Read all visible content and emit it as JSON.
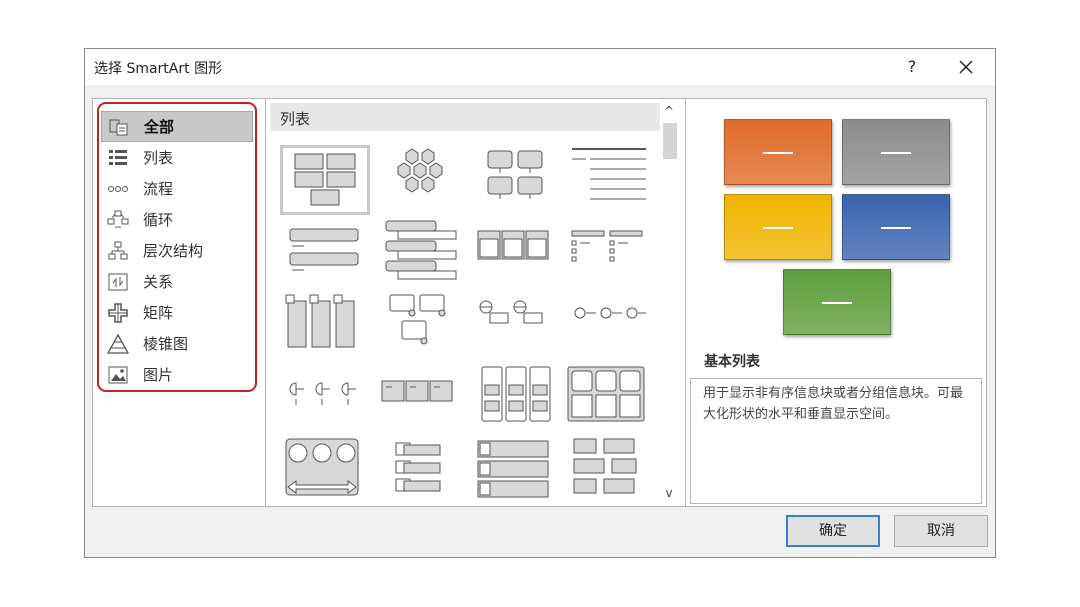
{
  "dialog": {
    "title": "选择 SmartArt 图形",
    "help": "?"
  },
  "categories": [
    {
      "label": "全部",
      "icon": "all-layouts-icon",
      "selected": true
    },
    {
      "label": "列表",
      "icon": "list-icon"
    },
    {
      "label": "流程",
      "icon": "process-icon"
    },
    {
      "label": "循环",
      "icon": "cycle-icon"
    },
    {
      "label": "层次结构",
      "icon": "hierarchy-icon"
    },
    {
      "label": "关系",
      "icon": "relationship-icon"
    },
    {
      "label": "矩阵",
      "icon": "matrix-icon"
    },
    {
      "label": "棱锥图",
      "icon": "pyramid-icon"
    },
    {
      "label": "图片",
      "icon": "picture-icon"
    }
  ],
  "gallery": {
    "heading": "列表",
    "scroll_up": "^",
    "scroll_down": "v"
  },
  "preview": {
    "name": "基本列表",
    "description": "用于显示非有序信息块或者分组信息块。可最大化形状的水平和垂直显示空间。",
    "colors": {
      "orange": "#e06b2a",
      "gray": "#8c8c8c",
      "yellow": "#f0b400",
      "blue": "#3a64b0",
      "green": "#5e9e3c"
    }
  },
  "buttons": {
    "ok": "确定",
    "cancel": "取消"
  }
}
